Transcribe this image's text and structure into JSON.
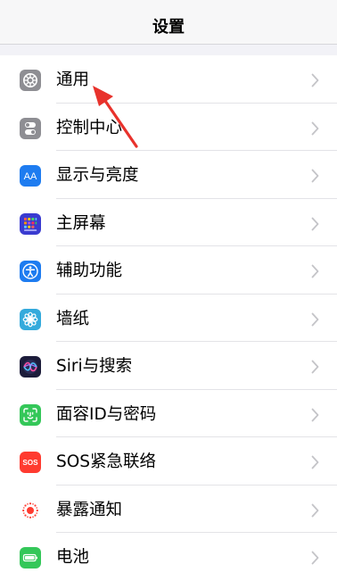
{
  "header": {
    "title": "设置"
  },
  "colors": {
    "general": "#8e8e93",
    "control_center": "#8e8e93",
    "display": "#1e7cf0",
    "home_screen": "#3a3bd0",
    "accessibility": "#1e7cf0",
    "wallpaper": "#34aadc",
    "siri": "#1c1c3a",
    "face_id": "#34c759",
    "sos": "#ff3b30",
    "exposure": "#ffffff",
    "battery": "#34c759",
    "annotation_arrow": "#e8322c"
  },
  "settings": {
    "items": [
      {
        "id": "general",
        "label": "通用",
        "icon": "gear-icon"
      },
      {
        "id": "control-center",
        "label": "控制中心",
        "icon": "toggles-icon"
      },
      {
        "id": "display",
        "label": "显示与亮度",
        "icon": "text-size-icon",
        "icon_text": "AA"
      },
      {
        "id": "home-screen",
        "label": "主屏幕",
        "icon": "app-grid-icon"
      },
      {
        "id": "accessibility",
        "label": "辅助功能",
        "icon": "accessibility-icon"
      },
      {
        "id": "wallpaper",
        "label": "墙纸",
        "icon": "flower-icon"
      },
      {
        "id": "siri",
        "label": "Siri与搜索",
        "icon": "siri-icon"
      },
      {
        "id": "face-id",
        "label": "面容ID与密码",
        "icon": "face-id-icon"
      },
      {
        "id": "sos",
        "label": "SOS紧急联络",
        "icon": "sos-icon",
        "icon_text": "SOS"
      },
      {
        "id": "exposure",
        "label": "暴露通知",
        "icon": "exposure-icon"
      },
      {
        "id": "battery",
        "label": "电池",
        "icon": "battery-icon"
      }
    ]
  }
}
